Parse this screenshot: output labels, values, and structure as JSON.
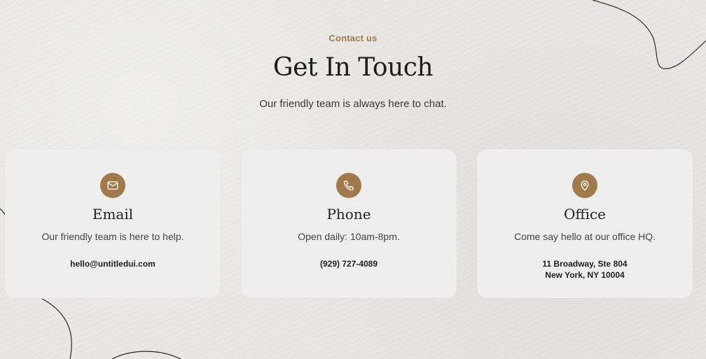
{
  "header": {
    "eyebrow": "Contact us",
    "title": "Get In Touch",
    "subtitle": "Our friendly team is always here to chat."
  },
  "cards": [
    {
      "icon": "mail-icon",
      "title": "Email",
      "description": "Our friendly team is here to help.",
      "detail_lines": [
        "hello@untitledui.com"
      ]
    },
    {
      "icon": "phone-icon",
      "title": "Phone",
      "description": "Open daily: 10am-8pm.",
      "detail_lines": [
        "(929) 727-4089"
      ]
    },
    {
      "icon": "map-pin-icon",
      "title": "Office",
      "description": "Come say hello at our office HQ.",
      "detail_lines": [
        "11 Broadway, Ste 804",
        "New York, NY 10004"
      ]
    }
  ],
  "colors": {
    "accent": "#a07b45",
    "icon_bg": "#a07a4a",
    "background": "#e9e8e7",
    "card_bg": "#efeeee"
  }
}
